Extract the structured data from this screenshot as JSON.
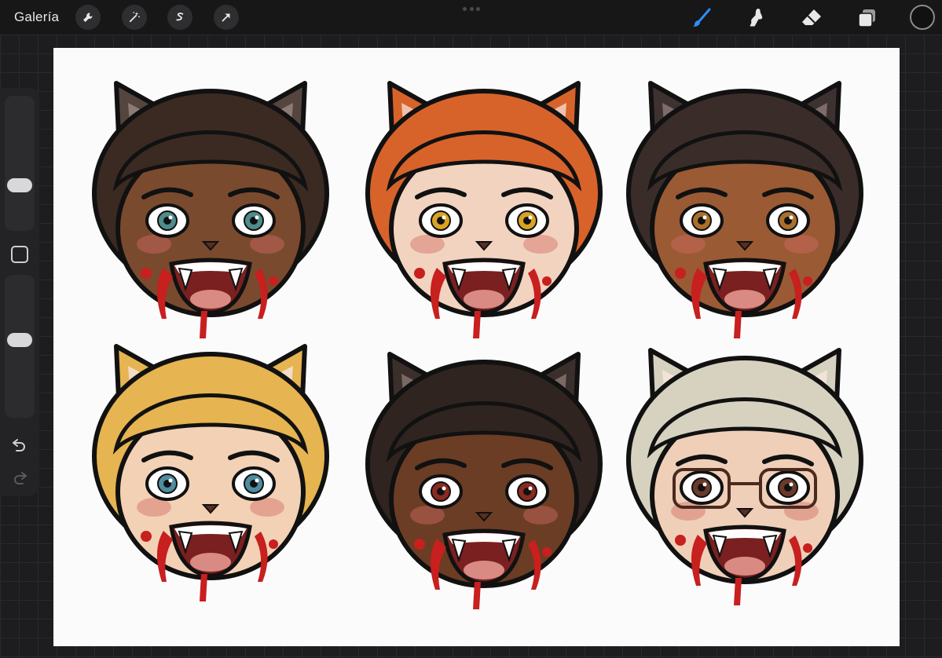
{
  "topbar": {
    "gallery_label": "Galería",
    "left_tools": [
      {
        "name": "wrench-icon"
      },
      {
        "name": "magic-wand-icon"
      },
      {
        "name": "selection-icon"
      },
      {
        "name": "transform-arrow-icon"
      }
    ],
    "right_tools": [
      {
        "name": "brush-icon",
        "active": true
      },
      {
        "name": "smudge-icon"
      },
      {
        "name": "eraser-icon"
      },
      {
        "name": "layers-icon"
      }
    ],
    "current_color": "#111111",
    "accent_color": "#2f8cff"
  },
  "sidebar": {
    "brush_size_level": 0.3,
    "opacity_level": 0.55,
    "icons": [
      "undo-icon",
      "redo-icon"
    ]
  },
  "canvas": {
    "background": "#fbfbfb",
    "faces": [
      {
        "skin": "#7a4a2e",
        "hair": "#3a2a22",
        "ear": "#54463f",
        "inner": "#8c7b75",
        "eye": "#4f8c8c"
      },
      {
        "skin": "#f2d3bf",
        "hair": "#d7632b",
        "ear": "#d7632b",
        "inner": "#f0c1ac",
        "eye": "#d9a323"
      },
      {
        "skin": "#9a5a34",
        "hair": "#3a2d29",
        "ear": "#3e3230",
        "inner": "#7d6c6a",
        "eye": "#a9702d"
      },
      {
        "skin": "#f3d1b5",
        "hair": "#e6b450",
        "ear": "#e6b450",
        "inner": "#f4dcc4",
        "eye": "#4f8ca0"
      },
      {
        "skin": "#6b3d24",
        "hair": "#2f241f",
        "ear": "#3b2f2b",
        "inner": "#7a6864",
        "eye": "#8a2a20"
      },
      {
        "skin": "#efcfb8",
        "hair": "#d7d2c0",
        "ear": "#d7d2c0",
        "inner": "#f0e4d6",
        "eye": "#6a3a2a",
        "glasses": true
      }
    ]
  }
}
